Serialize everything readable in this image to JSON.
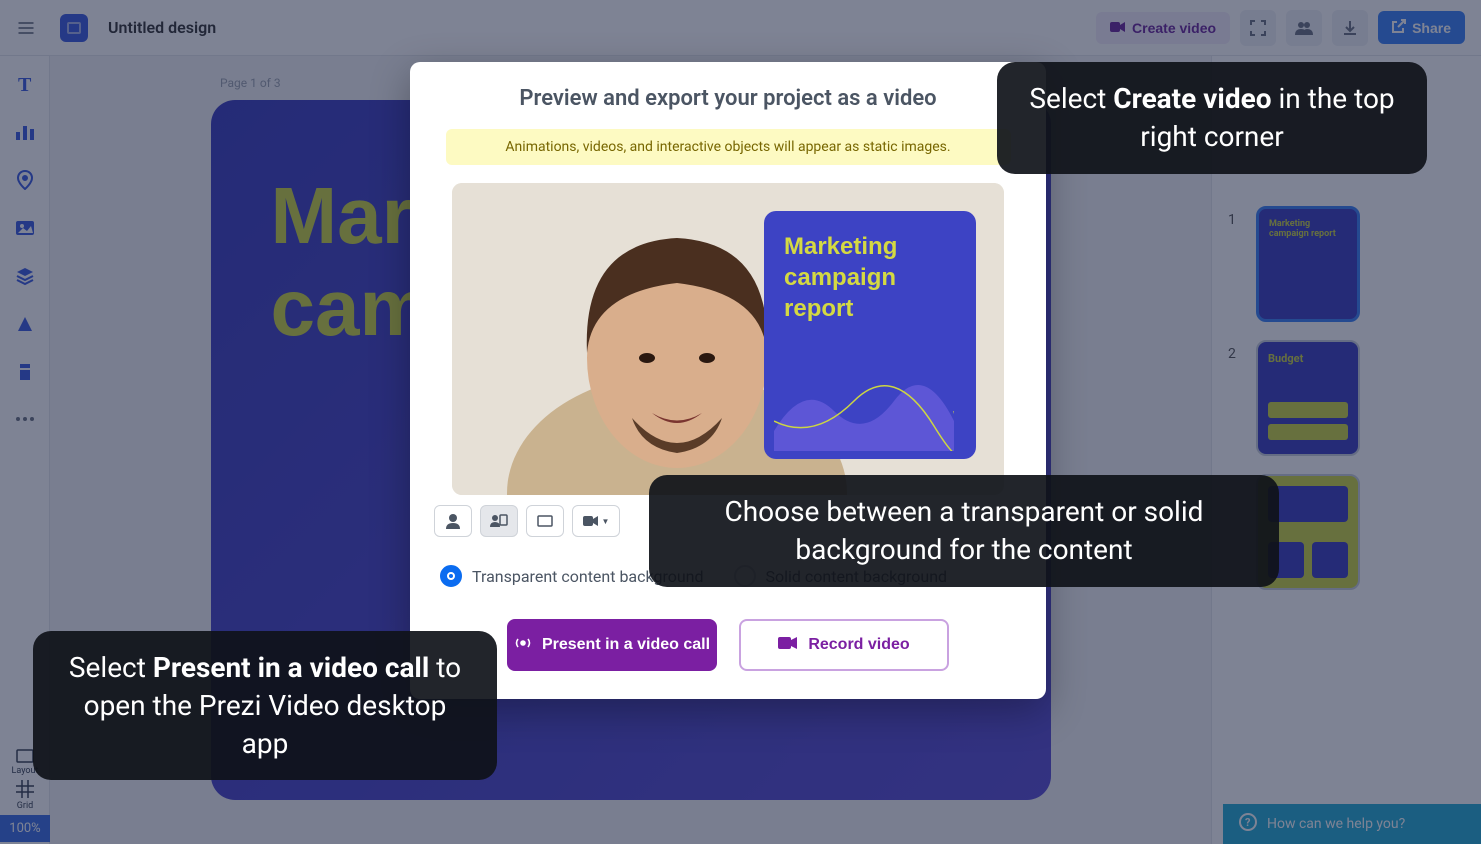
{
  "header": {
    "title": "Untitled design",
    "create_video": "Create video",
    "share": "Share"
  },
  "canvas": {
    "page_label": "Page 1 of 3",
    "slide_title": "Marketing campaign report"
  },
  "modal": {
    "title": "Preview and export your project as a video",
    "banner": "Animations, videos, and interactive objects will appear as static images.",
    "preview_card_title": "Marketing campaign report",
    "radio_transparent": "Transparent content background",
    "radio_solid": "Solid content background",
    "present_btn": "Present in a video call",
    "record_btn": "Record video"
  },
  "thumbs": {
    "t1_num": "1",
    "t1_title": "Marketing campaign report",
    "t2_num": "2",
    "t2_title": "Budget"
  },
  "footer": {
    "zoom": "100%",
    "layout_label": "Layout",
    "grid_label": "Grid",
    "help": "How can we help you?"
  },
  "annotations": {
    "a1_part1": "Select ",
    "a1_bold": "Create video",
    "a1_part2": " in the top right corner",
    "a2": "Choose between a transparent or solid background for the content",
    "a3_part1": "Select ",
    "a3_bold": "Present in a video call",
    "a3_part2": " to open the Prezi Video desktop app"
  }
}
